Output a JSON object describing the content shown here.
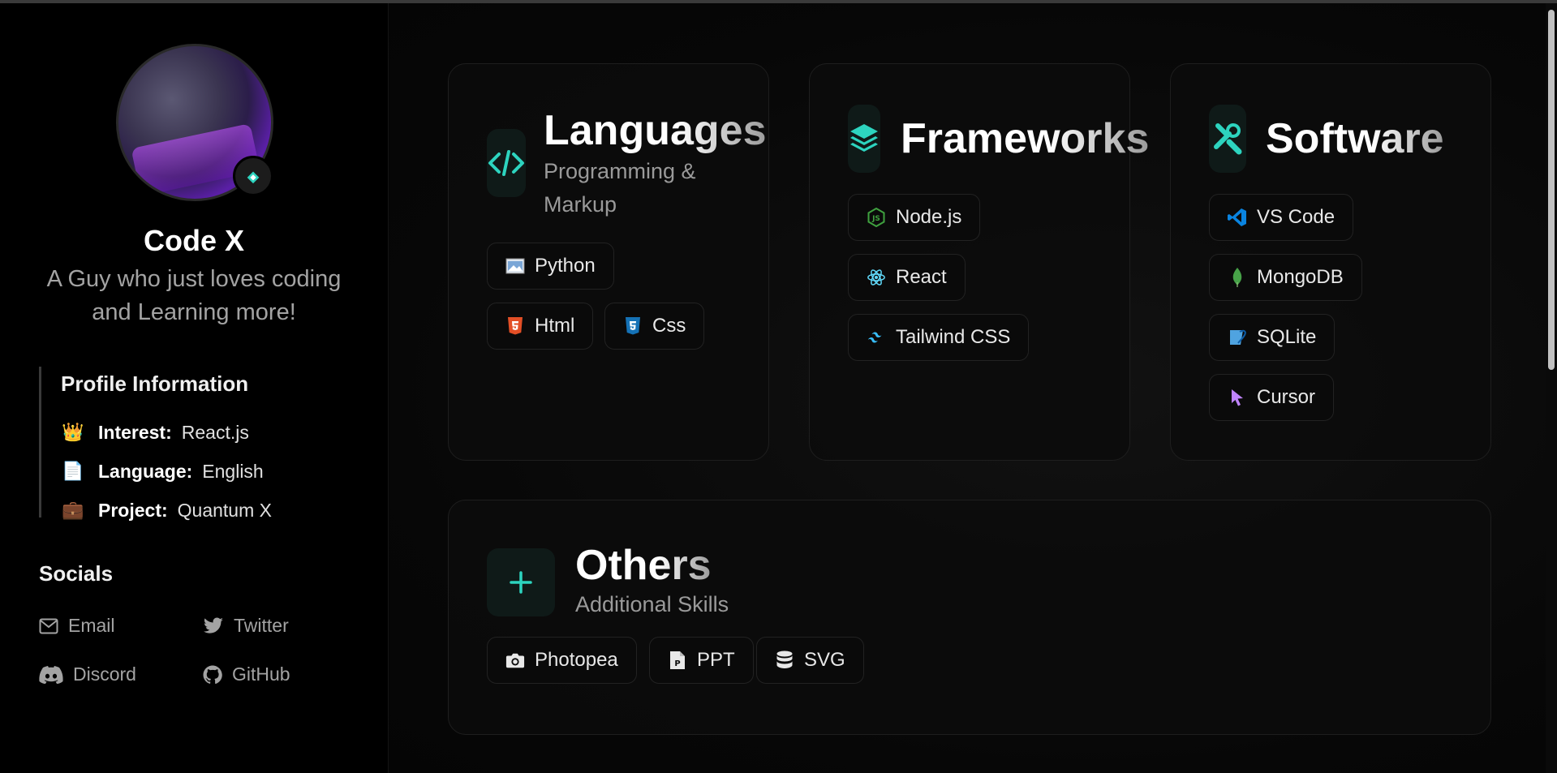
{
  "profile": {
    "name": "Code X",
    "tagline": "A Guy who just loves coding and Learning more!",
    "info_title": "Profile Information",
    "rows": [
      {
        "icon": "crown-icon",
        "key": "Interest:",
        "value": "React.js"
      },
      {
        "icon": "document-icon",
        "key": "Language:",
        "value": "English"
      },
      {
        "icon": "briefcase-icon",
        "key": "Project:",
        "value": "Quantum X"
      }
    ]
  },
  "socials": {
    "title": "Socials",
    "items": [
      {
        "label": "Email",
        "icon": "mail-icon"
      },
      {
        "label": "Twitter",
        "icon": "twitter-icon"
      },
      {
        "label": "Discord",
        "icon": "discord-icon"
      },
      {
        "label": "GitHub",
        "icon": "github-icon"
      }
    ]
  },
  "cards": {
    "languages": {
      "title": "Languages",
      "subtitle": "Programming & Markup",
      "icon": "code-icon",
      "chips": [
        "Python",
        "Html",
        "Css"
      ]
    },
    "frameworks": {
      "title": "Frameworks",
      "icon": "layers-icon",
      "chips": [
        "Node.js",
        "React",
        "Tailwind CSS"
      ]
    },
    "software": {
      "title": "Software",
      "icon": "tools-icon",
      "chips": [
        "VS Code",
        "MongoDB",
        "SQLite",
        "Cursor"
      ]
    },
    "others": {
      "title": "Others",
      "subtitle": "Additional Skills",
      "icon": "plus-icon",
      "chips": [
        "Photopea",
        "PPT",
        "SVG"
      ]
    }
  },
  "colors": {
    "accent": "#2dd4bf",
    "background": "#000000",
    "card_border": "#1e1e1e",
    "muted_text": "#a3a3a3"
  }
}
